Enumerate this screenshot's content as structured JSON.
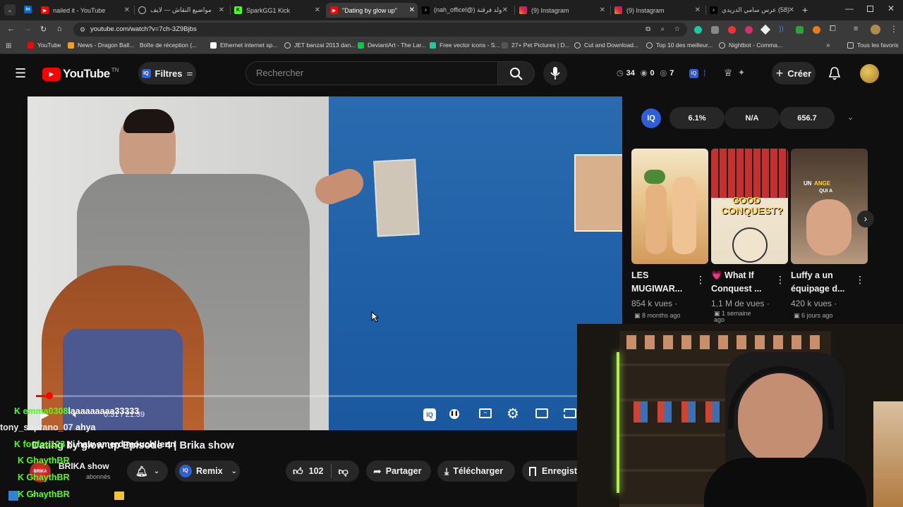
{
  "tabs": [
    {
      "title": "nailed it - YouTube",
      "fav": "yt"
    },
    {
      "title": "مواضيع النقاش — لايف",
      "fav": "globe"
    },
    {
      "title": "SparkGG1 Kick",
      "fav": "kick"
    },
    {
      "title": "\"Dating by glow up\"",
      "fav": "yt",
      "active": true
    },
    {
      "title": "ولد فرقنة (@nah_officel)",
      "fav": "tiktok"
    },
    {
      "title": "(9) Instagram",
      "fav": "ig"
    },
    {
      "title": "(9) Instagram",
      "fav": "ig"
    },
    {
      "title": "(58) عرس سامي الدريدي",
      "fav": "tiktok"
    }
  ],
  "address": {
    "url": "youtube.com/watch?v=7ch-3Z9Bjbs"
  },
  "bookmarks": [
    "YouTube",
    "News - Dragon Ball...",
    "Boîte de réception (...",
    "Ethernet internet sp...",
    "JET banzai 2013 dan...",
    "DeviantArt - The Lar...",
    "Free vector icons - S...",
    "27+ Pet Pictures | D...",
    "Cut and Download...",
    "Top 10 des meilleur...",
    "Nightbot - Comma..."
  ],
  "bookmarks_all": "Tous les favoris",
  "yt": {
    "logo": "YouTube",
    "country": "TN",
    "filter": "Filtres",
    "search_placeholder": "Rechercher",
    "stats": [
      "34",
      "0",
      "7"
    ],
    "create": "Créer"
  },
  "panel": {
    "badge": "IQ",
    "stats": [
      "6.1%",
      "N/A",
      "656.7"
    ]
  },
  "recs": [
    {
      "title": "LES MUGIWAR...",
      "views": "854 k vues ·",
      "age": "8 months ago"
    },
    {
      "title": "💗 What If Conquest ...",
      "views": "1,1 M de vues ·",
      "age": "1 semaine ago"
    },
    {
      "title": "Luffy a un équipage d...",
      "views": "420 k vues ·",
      "age": "6 jours ago"
    }
  ],
  "thumb_text": {
    "good": "GOOD",
    "conquest": "CONQUEST?",
    "un": "UN",
    "ange": "ANGE",
    "quia": "QUI A"
  },
  "player": {
    "time": "0:31 / 21:39"
  },
  "video_title": "Dating by glow up Episode 4 | Brika show",
  "channel": {
    "name": "BRIKA show",
    "subs": "abonnés"
  },
  "actions": {
    "remix": "Remix",
    "likes": "102",
    "share": "Partager",
    "download": "Télécharger",
    "save": "Enregist"
  },
  "chat": [
    {
      "user": "emma0308",
      "msg": "laaaaaaaaa33333",
      "color": "#53fc18",
      "badge": true
    },
    {
      "user": "tony_soprano_07",
      "msg": "ahya",
      "color": "#e8e8e8",
      "badge": false
    },
    {
      "user": "foufou123",
      "msg": "t'i haw amerd mouch lenn",
      "color": "#53fc18",
      "badge": true
    },
    {
      "user": "GhaythBR",
      "msg": "",
      "color": "#53fc18",
      "badge": true
    },
    {
      "user": "GhaythBR",
      "msg": "",
      "color": "#53fc18",
      "badge": true
    },
    {
      "user": "GhaythBR",
      "msg": "",
      "color": "#53fc18",
      "badge": true
    }
  ],
  "colors": {
    "accent": "#ff0000",
    "kick": "#53fc18",
    "iq": "#2f5fd6"
  }
}
